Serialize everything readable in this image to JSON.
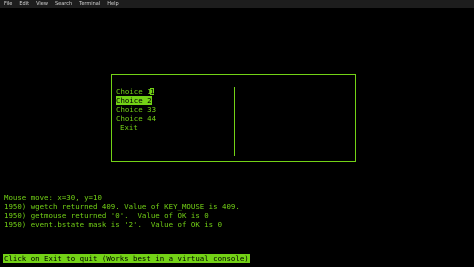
{
  "menubar": [
    "File",
    "Edit",
    "View",
    "Search",
    "Terminal",
    "Help"
  ],
  "menu": {
    "items": [
      "Choice 1",
      "Choice 2",
      "Choice 3",
      "Choice 4",
      "Exit"
    ],
    "item_suffix": [
      "",
      "",
      "3",
      "4",
      ""
    ],
    "cursor_char": "1"
  },
  "log": [
    "Mouse move: x=30, y=10",
    "1950) wgetch returned 409. Value of KEY_MOUSE is 409.",
    "1950) getmouse returned '0'.  Value of OK is 0",
    "1950) event.bstate mask is '2'.  Value of OK is 0"
  ],
  "status": "Click on Exit to quit (Works best in a virtual console)",
  "colors": {
    "foreground": "#73d216",
    "background": "#000000",
    "menubar": "#1d1d1d"
  }
}
